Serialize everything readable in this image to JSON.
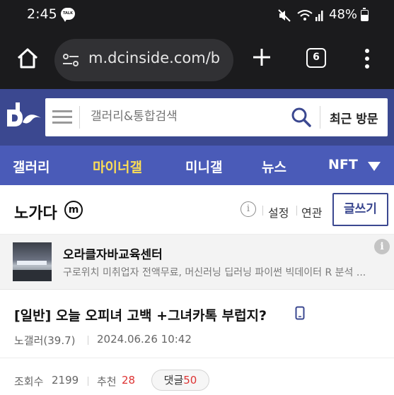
{
  "status_bar": {
    "time": "2:45",
    "talk_badge": "TALK",
    "battery_percent": "48%",
    "battery_level": 0.48,
    "icons": [
      "kakaotalk-icon",
      "mute-icon",
      "wifi-icon",
      "signal-icon",
      "battery-icon"
    ]
  },
  "browser": {
    "url": "m.dcinside.com/b",
    "tab_count": "6",
    "icons": [
      "home-icon",
      "site-settings-icon",
      "new-tab-icon",
      "tab-switcher-icon",
      "more-menu-icon"
    ]
  },
  "header": {
    "search_placeholder": "갤러리&통합검색",
    "recent_visits_label": "최근 방문",
    "brand_color": "#3b4890"
  },
  "nav": {
    "items": [
      {
        "label": "갤러리",
        "active": false
      },
      {
        "label": "마이너갤",
        "active": true
      },
      {
        "label": "미니갤",
        "active": false
      },
      {
        "label": "뉴스",
        "active": false
      },
      {
        "label": "NFT",
        "active": false
      }
    ],
    "active_color": "#fdde55",
    "bg_color": "#4a5bb8"
  },
  "gallery": {
    "title": "노가다",
    "badge": "m",
    "settings_label": "설정",
    "related_label": "연관",
    "write_label": "글쓰기"
  },
  "ad": {
    "title": "오라클자바교육센터",
    "description": "구로위치 미취업자 전액무료, 머신러닝 딥러닝 파이썬 빅데이터 R 분석 ..."
  },
  "post": {
    "title": "[일반] 오늘 오피녀 고백 +그녀카톡 부럽지?",
    "author": "노갤러(39.7)",
    "date": "2024.06.26 10:42"
  },
  "stats": {
    "views_label": "조회수",
    "views": "2199",
    "recommend_label": "추천",
    "recommend": "28",
    "comments_label": "댓글",
    "comments": "50"
  }
}
